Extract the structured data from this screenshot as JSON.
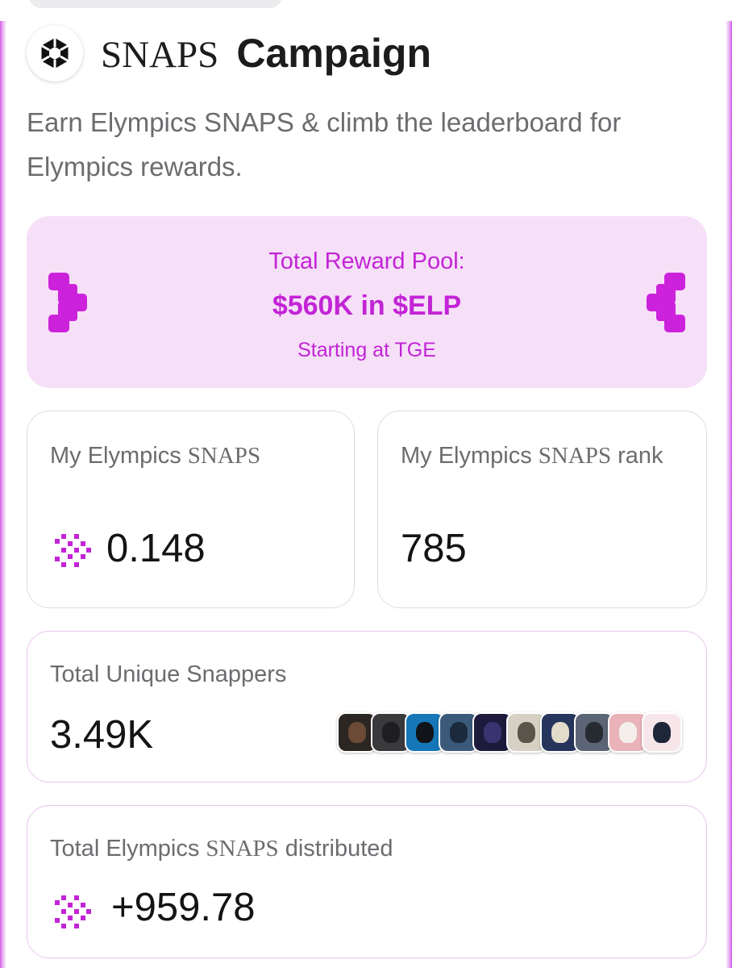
{
  "header": {
    "title_brand": "SNAPS",
    "title_rest": "Campaign",
    "subtitle": "Earn Elympics SNAPS & climb the leaderboard for Elympics rewards."
  },
  "reward_pool": {
    "label": "Total Reward Pool:",
    "amount": "$560K in $ELP",
    "start": "Starting at TGE"
  },
  "my_snaps": {
    "label_prefix": "My Elympics",
    "label_brand": "SNAPS",
    "value": "0.148"
  },
  "my_rank": {
    "label_prefix": "My Elympics",
    "label_brand": "SNAPS",
    "label_suffix": "rank",
    "value": "785"
  },
  "unique_snappers": {
    "label": "Total Unique Snappers",
    "value": "3.49K",
    "avatars": [
      {
        "bg": "#2b2622",
        "face": "#6b4a36"
      },
      {
        "bg": "#3a3a3d",
        "face": "#1e1e20"
      },
      {
        "bg": "#1677b8",
        "face": "#101418"
      },
      {
        "bg": "#3b5a7a",
        "face": "#1b2a3d"
      },
      {
        "bg": "#1d1a3c",
        "face": "#3b3270"
      },
      {
        "bg": "#d6d1c4",
        "face": "#59554b"
      },
      {
        "bg": "#26355c",
        "face": "#e3dccb"
      },
      {
        "bg": "#5c6575",
        "face": "#262a31"
      },
      {
        "bg": "#e9b3b9",
        "face": "#f4efea"
      },
      {
        "bg": "#f6e6ea",
        "face": "#1f2638"
      }
    ]
  },
  "distributed": {
    "label_prefix": "Total Elympics",
    "label_brand": "SNAPS",
    "label_suffix": "distributed",
    "value": "+959.78"
  },
  "colors": {
    "accent": "#c224d6",
    "pool_bg": "#f6e0f8",
    "muted_text": "#6c6c70"
  },
  "icons": {
    "logo": "elympics-logo-icon",
    "snaps": "snaps-dots-icon",
    "deco": "pixel-connector-icon"
  }
}
